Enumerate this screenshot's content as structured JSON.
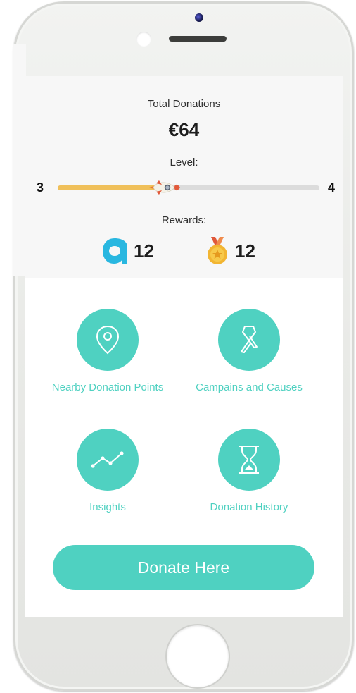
{
  "summary": {
    "total_label": "Total Donations",
    "total_value": "€64",
    "level_label": "Level:",
    "level_current": "3",
    "level_next": "4",
    "level_progress": 0.44,
    "rewards_label": "Rewards:",
    "rewards": [
      {
        "icon": "a-coin-icon",
        "count": "12"
      },
      {
        "icon": "medal-icon",
        "count": "12"
      }
    ]
  },
  "menu": [
    {
      "icon": "location-pin-icon",
      "label": "Nearby Donation Points"
    },
    {
      "icon": "ribbon-icon",
      "label": "Campains and Causes"
    },
    {
      "icon": "trend-line-icon",
      "label": "Insights"
    },
    {
      "icon": "hourglass-icon",
      "label": "Donation History"
    }
  ],
  "donate_button": "Donate Here",
  "colors": {
    "accent": "#4fd1c1",
    "progress_fill": "#f0c05a",
    "coin": "#29b7e0",
    "medal": "#f2b532",
    "medal_ribbon": "#e0583a"
  }
}
